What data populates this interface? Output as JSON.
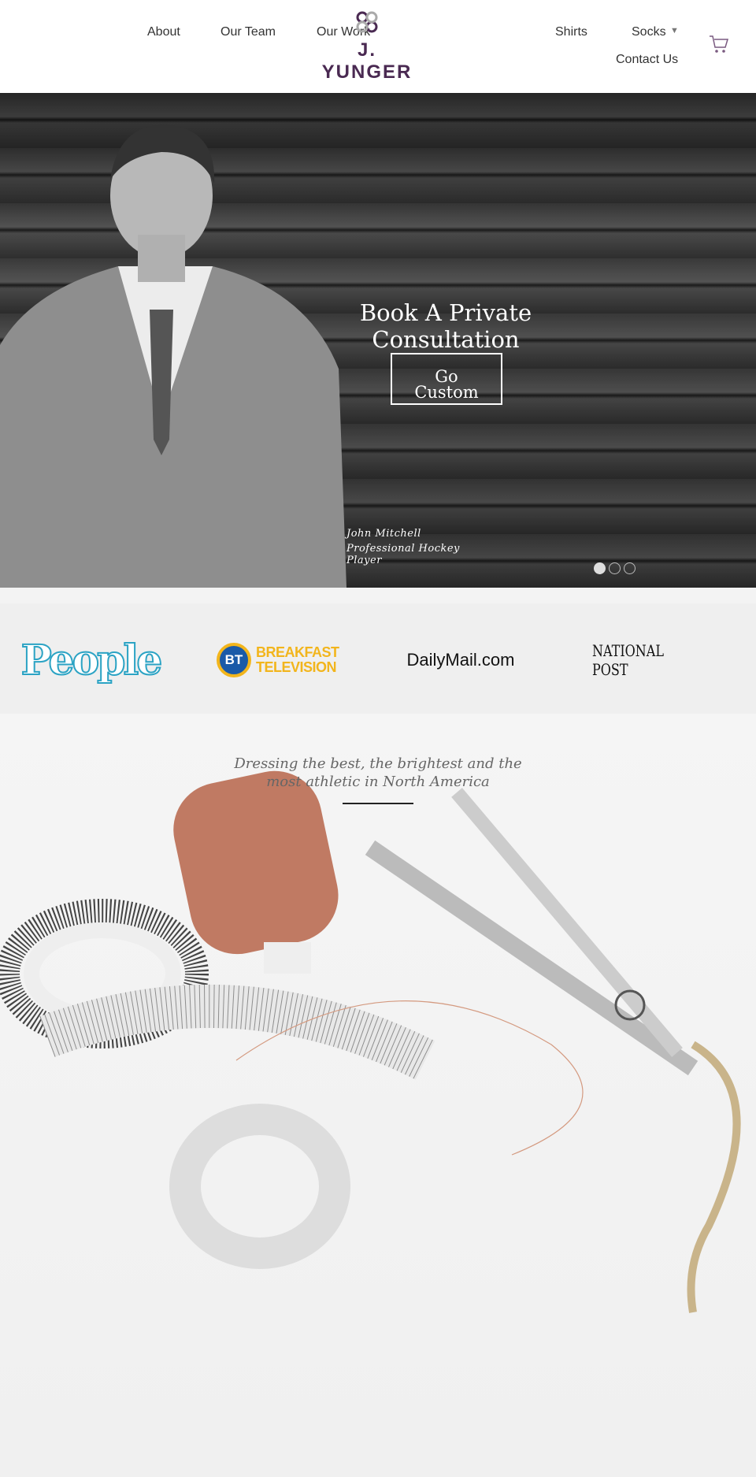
{
  "header": {
    "nav_left": [
      "About",
      "Our Team",
      "Our Work"
    ],
    "nav_right": [
      "Shirts",
      "Socks",
      "Contact Us"
    ],
    "socks_dropdown_icon": "triangle-down",
    "logo_text": "J. YUNGER",
    "cart_icon": "shopping-cart",
    "brand_color": "#4a2a52"
  },
  "hero": {
    "title": "Book A Private Consultation",
    "cta_line1": "Go",
    "cta_line2": "Custom",
    "caption_name": "John Mitchell",
    "caption_role_line1": "Professional Hockey",
    "caption_role_line2": "Player",
    "slides": 3,
    "active_slide": 1
  },
  "press": {
    "logos": [
      "People",
      "BREAKFAST TELEVISION",
      "DailyMail.com",
      "NATIONAL POST"
    ],
    "bt_badge": "BT"
  },
  "story": {
    "tagline": "Dressing the best, the brightest and the most athletic in North America"
  }
}
